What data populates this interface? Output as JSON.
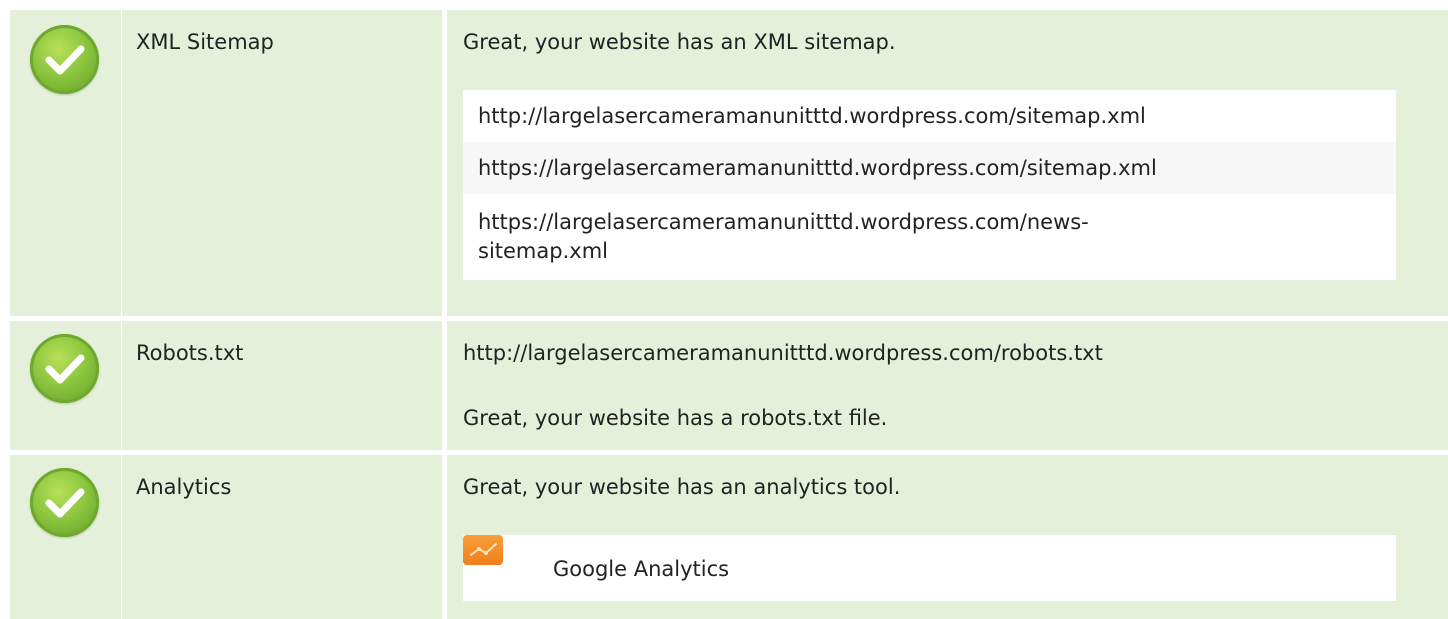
{
  "checks": [
    {
      "label": "XML Sitemap",
      "message": "Great, your website has an XML sitemap.",
      "urls": [
        "http://largelasercameramanunitttd.wordpress.com/sitemap.xml",
        "https://largelasercameramanunitttd.wordpress.com/sitemap.xml",
        "https://largelasercameramanunitttd.wordpress.com/news-sitemap.xml"
      ],
      "status_icon": "check-circle-icon"
    },
    {
      "label": "Robots.txt",
      "url": "http://largelasercameramanunitttd.wordpress.com/robots.txt",
      "message": "Great, your website has a robots.txt file.",
      "status_icon": "check-circle-icon"
    },
    {
      "label": "Analytics",
      "message": "Great, your website has an analytics tool.",
      "tools": [
        {
          "name": "Google Analytics",
          "icon": "google-analytics-icon"
        }
      ],
      "status_icon": "check-circle-icon"
    }
  ],
  "colors": {
    "row_background": "#e4f0da",
    "check_green": "#8cc63f",
    "analytics_orange": "#f29a2e"
  }
}
